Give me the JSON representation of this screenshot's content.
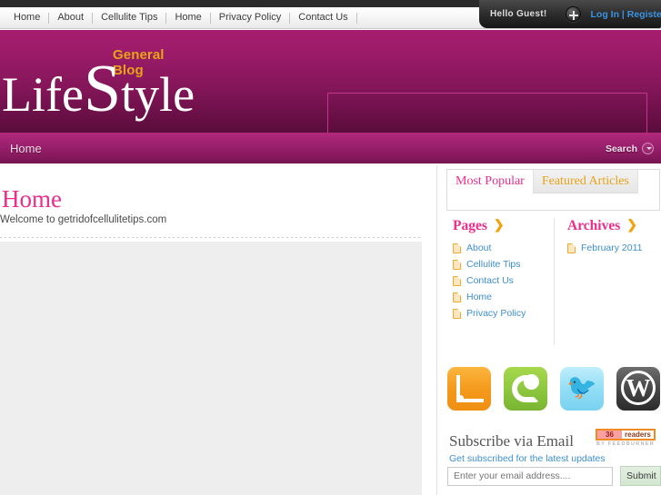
{
  "topnav": {
    "items": [
      {
        "label": "Home"
      },
      {
        "label": "About"
      },
      {
        "label": "Cellulite Tips"
      },
      {
        "label": "Home"
      },
      {
        "label": "Privacy Policy"
      },
      {
        "label": "Contact Us"
      }
    ]
  },
  "userbar": {
    "greeting": "Hello Guest!",
    "plus_icon": "plus-circle-icon",
    "auth_label": "Log In | Register"
  },
  "masthead": {
    "tagline": "General Blog",
    "logo_part1": "Life",
    "logo_part2": "S",
    "logo_part3": "tyle",
    "banner_placeholder": ""
  },
  "menubar": {
    "home_label": "Home",
    "search_label": "Search",
    "search_icon": "chevron-down-circle-icon"
  },
  "main": {
    "title": "Home",
    "welcome_text": "Welcome to getridofcellulitetips.com"
  },
  "sidebar": {
    "tabs": [
      {
        "label": "Most Popular",
        "active": true
      },
      {
        "label": "Featured Articles",
        "active": false
      }
    ],
    "pages_widget": {
      "heading": "Pages",
      "arrow_icon": "chevron-right-icon",
      "items": [
        {
          "label": "About",
          "icon": "page-icon"
        },
        {
          "label": "Cellulite Tips",
          "icon": "page-icon"
        },
        {
          "label": "Contact Us",
          "icon": "page-icon"
        },
        {
          "label": "Home",
          "icon": "page-icon"
        },
        {
          "label": "Privacy Policy",
          "icon": "page-icon"
        }
      ]
    },
    "archives_widget": {
      "heading": "Archives",
      "arrow_icon": "chevron-right-icon",
      "items": [
        {
          "label": "February 2011",
          "icon": "page-icon"
        }
      ]
    },
    "socials": [
      {
        "name": "rss-icon",
        "title": "RSS"
      },
      {
        "name": "technorati-icon",
        "title": "Technorati"
      },
      {
        "name": "twitter-icon",
        "title": "Twitter"
      },
      {
        "name": "wordpress-icon",
        "title": "WordPress",
        "glyph": "W"
      }
    ],
    "subscribe": {
      "title": "Subscribe via Email",
      "link_text": "Get subscribed for the latest updates",
      "feedburner": {
        "count": "36",
        "readers_label": "readers",
        "byline": "BY FEEDBURNER"
      },
      "input_placeholder": "Enter your email address....",
      "input_value": "",
      "submit_label": "Submit"
    }
  },
  "colors": {
    "brand_magenta": "#a61d70",
    "accent_pink": "#ec2d8b",
    "accent_orange": "#e8a317",
    "link_blue": "#3d8fd1"
  }
}
